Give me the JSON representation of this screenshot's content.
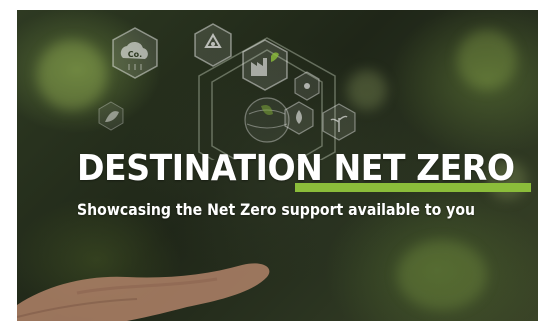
{
  "banner": {
    "headline": "DESTINATION NET ZERO",
    "subheadline": "Showcasing the Net Zero support available to you",
    "icon_texts": {
      "co2": "Co."
    },
    "icons": [
      "co2-cloud-icon",
      "recycle-icon",
      "factory-icon",
      "atom-icon",
      "water-drop-icon",
      "plant-icon",
      "leaf-icon",
      "globe-icon"
    ],
    "colors": {
      "accent": "#8bbd3a",
      "text": "#ffffff",
      "background": "#1f2618"
    }
  }
}
